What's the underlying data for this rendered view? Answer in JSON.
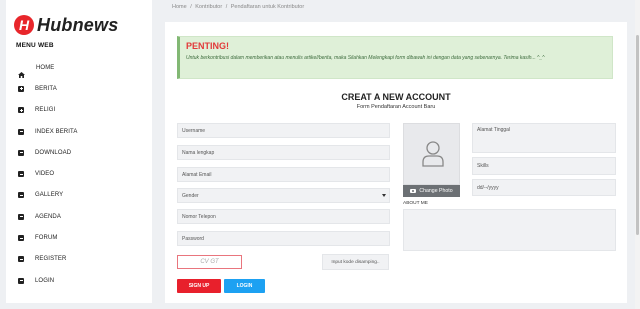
{
  "brand": {
    "logo_letter": "H",
    "name": "Hubnews",
    "accent": "#e8262b"
  },
  "sidebar": {
    "title": "MENU WEB",
    "items": [
      {
        "label": "HOME",
        "icon": "home-icon"
      },
      {
        "label": "BERITA",
        "icon": "plus-square-icon"
      },
      {
        "label": "RELIGI",
        "icon": "plus-square-icon"
      },
      {
        "label": "INDEX BERITA",
        "icon": "minus-square-icon"
      },
      {
        "label": "DOWNLOAD",
        "icon": "minus-square-icon"
      },
      {
        "label": "VIDEO",
        "icon": "minus-square-icon"
      },
      {
        "label": "GALLERY",
        "icon": "minus-square-icon"
      },
      {
        "label": "AGENDA",
        "icon": "minus-square-icon"
      },
      {
        "label": "FORUM",
        "icon": "minus-square-icon"
      },
      {
        "label": "REGISTER",
        "icon": "minus-square-icon"
      },
      {
        "label": "LOGIN",
        "icon": "minus-square-icon"
      }
    ]
  },
  "breadcrumb": {
    "items": [
      "Home",
      "Kontributor",
      "Pendaftaran untuk Kontributor"
    ],
    "separator": "/"
  },
  "alert": {
    "title": "PENTING!",
    "text": "Untuk berkontribusi dalam memberikan atau menulis artikel/berita, maka Silahkan Melengkapi form dibawah ini dengan data yang sebenarnya. Terima kasih... ^_^",
    "bg_color": "#dff0d8",
    "title_color": "#e23a3a"
  },
  "form": {
    "title": "CREAT A NEW ACCOUNT",
    "subtitle": "Form Pendaftaran Account Baru",
    "fields": {
      "username": "Username",
      "fullname": "Nama lengkap",
      "email": "Alamat Email",
      "gender": "Gender",
      "phone": "Nomor Telepon",
      "password": "Password",
      "address": "Alamat Tinggal",
      "skills": "Skills",
      "dob": "dd/--/yyyy"
    },
    "change_photo": "Change Photo",
    "about_label": "ABOUT ME",
    "captcha_text": "CV  GT",
    "captcha_hint": "Input kode disamping..",
    "signup_label": "SIGN UP",
    "login_label": "LOGIN",
    "signup_color": "#e8202c",
    "login_color": "#1da1f2"
  }
}
